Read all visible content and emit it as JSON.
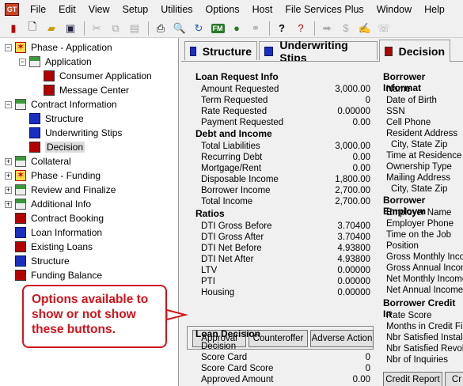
{
  "app_icon": "GT",
  "menu": [
    "File",
    "Edit",
    "View",
    "Setup",
    "Utilities",
    "Options",
    "Host",
    "File Services Plus",
    "Window",
    "Help"
  ],
  "toolbar": {
    "icons": [
      "new-icon",
      "open-icon",
      "save-icon",
      "cut-icon",
      "copy-icon",
      "paste-icon",
      "print-icon",
      "preview-icon",
      "refresh-icon",
      "fm-icon",
      "globe-icon",
      "network-icon",
      "help-icon",
      "whats-this-icon",
      "arrow-icon",
      "dollar-icon",
      "sign-icon",
      "phone-icon"
    ],
    "fm_label": "FM"
  },
  "tree": [
    {
      "label": "Phase - Application",
      "icon": "star",
      "expander": "−",
      "level": 0
    },
    {
      "label": "Application",
      "icon": "book",
      "expander": "−",
      "level": 1
    },
    {
      "label": "Consumer Application",
      "icon": "red",
      "expander": "",
      "level": 2
    },
    {
      "label": "Message Center",
      "icon": "red",
      "expander": "",
      "level": 2
    },
    {
      "label": "Contract Information",
      "icon": "book",
      "expander": "−",
      "level": 0
    },
    {
      "label": "Structure",
      "icon": "blue",
      "expander": "",
      "level": 1
    },
    {
      "label": "Underwriting Stips",
      "icon": "blue",
      "expander": "",
      "level": 1
    },
    {
      "label": "Decision",
      "icon": "red",
      "expander": "",
      "level": 1,
      "selected": true
    },
    {
      "label": "Collateral",
      "icon": "book",
      "expander": "+",
      "level": 0
    },
    {
      "label": "Phase - Funding",
      "icon": "star",
      "expander": "+",
      "level": 0
    },
    {
      "label": "Review and Finalize",
      "icon": "book",
      "expander": "+",
      "level": 0
    },
    {
      "label": "Additional Info",
      "icon": "book",
      "expander": "+",
      "level": 0
    },
    {
      "label": "Contract Booking",
      "icon": "red",
      "expander": "",
      "level": 0
    },
    {
      "label": "Loan Information",
      "icon": "blue",
      "expander": "",
      "level": 0
    },
    {
      "label": "Existing Loans",
      "icon": "red",
      "expander": "",
      "level": 0
    },
    {
      "label": "Structure",
      "icon": "blue",
      "expander": "",
      "level": 0
    },
    {
      "label": "Funding Balance",
      "icon": "red",
      "expander": "",
      "level": 0
    }
  ],
  "tabs": [
    {
      "label": "Structure",
      "icon": "blue"
    },
    {
      "label": "Underwriting Stips",
      "icon": "blue"
    },
    {
      "label": "Decision",
      "icon": "red",
      "active": true
    }
  ],
  "loan_request": {
    "title": "Loan Request Info",
    "rows": [
      {
        "label": "Amount Requested",
        "value": "3,000.00"
      },
      {
        "label": "Term Requested",
        "value": "0"
      },
      {
        "label": "Rate Requested",
        "value": "0.00000"
      },
      {
        "label": "Payment Requested",
        "value": "0.00"
      }
    ]
  },
  "debt_income": {
    "title": "Debt and Income",
    "rows": [
      {
        "label": "Total Liabilities",
        "value": "3,000.00"
      },
      {
        "label": "Recurring Debt",
        "value": "0.00"
      },
      {
        "label": "Mortgage/Rent",
        "value": "0.00"
      },
      {
        "label": "Disposable Income",
        "value": "1,800.00"
      },
      {
        "label": "Borrower Income",
        "value": "2,700.00"
      },
      {
        "label": "Total Income",
        "value": "2,700.00"
      }
    ]
  },
  "ratios": {
    "title": "Ratios",
    "rows": [
      {
        "label": "DTI Gross Before",
        "value": "3.70400"
      },
      {
        "label": "DTI Gross After",
        "value": "3.70400"
      },
      {
        "label": "DTI Net Before",
        "value": "4.93800"
      },
      {
        "label": "DTI Net After",
        "value": "4.93800"
      },
      {
        "label": "LTV",
        "value": "0.00000"
      },
      {
        "label": "PTI",
        "value": "0.00000"
      },
      {
        "label": "Housing",
        "value": "0.00000"
      }
    ]
  },
  "decision_buttons": [
    "Approval",
    "Counteroffer",
    "Adverse Action"
  ],
  "loan_decision": {
    "title": "Loan Decision",
    "rows": [
      {
        "label": "Decision",
        "value": ""
      },
      {
        "label": "Score Card",
        "value": "0"
      },
      {
        "label": "Score Card Score",
        "value": "0"
      },
      {
        "label": "Approved Amount",
        "value": "0.00"
      }
    ]
  },
  "borrower_info": {
    "title": "Borrower Informat",
    "rows": [
      "Name",
      "Date of Birth",
      "SSN",
      "Cell Phone",
      "Resident Address",
      "City, State  Zip",
      "Time at Residence",
      "Ownership Type",
      "Mailing Address",
      "City, State  Zip"
    ]
  },
  "borrower_employment": {
    "title": "Borrower Employm",
    "rows": [
      "Employer Name",
      "Employer Phone",
      "Time on the Job",
      "Position",
      "Gross Monthly Incon",
      "Gross Annual Incom",
      "Net Monthly Income",
      "Net Annual Income"
    ]
  },
  "borrower_credit": {
    "title": "Borrower Credit In",
    "rows": [
      "Rate Score",
      "Months in Credit File",
      "Nbr Satisfied Installm",
      "Nbr Satisfied Revolvi",
      "Nbr of Inquiries"
    ]
  },
  "right_buttons": [
    "Credit Report",
    "Cr"
  ],
  "callout": "Options available to show or not show these buttons.",
  "colors": {
    "callout": "#d0141c",
    "selected": "#dddddd",
    "blue_icon": "#1a2fc0",
    "red_icon": "#cc0000"
  }
}
